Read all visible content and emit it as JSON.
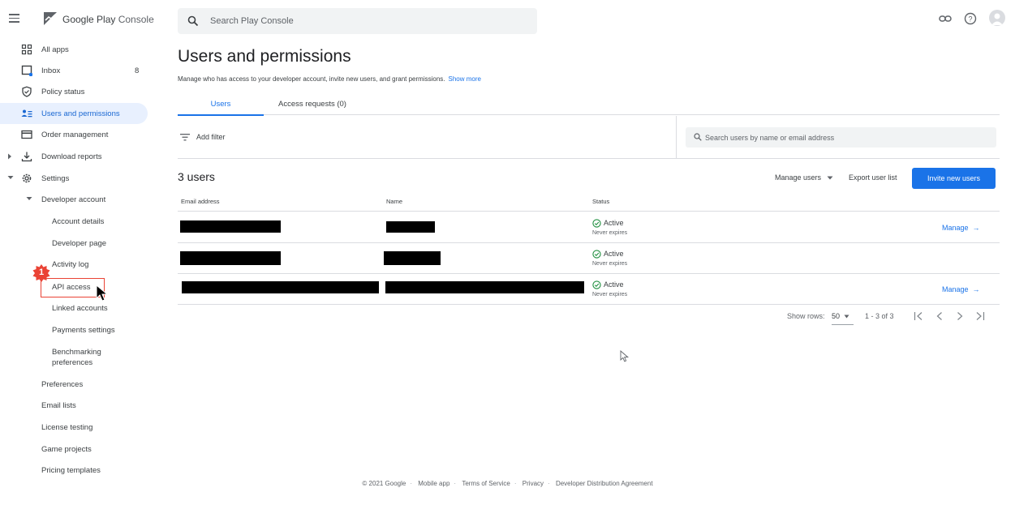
{
  "topbar": {
    "brand": "Google Play",
    "brand_suffix": "Console",
    "search_placeholder": "Search Play Console"
  },
  "sidebar": {
    "items": [
      {
        "label": "All apps",
        "icon": "grid-icon"
      },
      {
        "label": "Inbox",
        "icon": "inbox-icon",
        "count": "8"
      },
      {
        "label": "Policy status",
        "icon": "shield-icon"
      },
      {
        "label": "Users and permissions",
        "icon": "users-icon",
        "active": true
      },
      {
        "label": "Order management",
        "icon": "card-icon"
      },
      {
        "label": "Download reports",
        "icon": "download-icon"
      },
      {
        "label": "Settings",
        "icon": "gear-icon"
      }
    ],
    "developer_account": "Developer account",
    "sub_items": [
      "Account details",
      "Developer page",
      "Activity log",
      "API access",
      "Linked accounts",
      "Payments settings",
      "Benchmarking",
      "preferences"
    ],
    "settings_items": [
      "Preferences",
      "Email lists",
      "License testing",
      "Game projects",
      "Pricing templates"
    ],
    "step_badge": "1"
  },
  "main": {
    "title": "Users and permissions",
    "description": "Manage who has access to your developer account, invite new users, and grant permissions.",
    "show_more": "Show more",
    "tabs": [
      "Users",
      "Access requests (0)"
    ],
    "filter_label": "Add filter",
    "user_search_placeholder": "Search users by name or email address",
    "users_count": "3 users",
    "manage_users": "Manage users",
    "export_list": "Export user list",
    "invite_button": "Invite new users",
    "columns": [
      "Email address",
      "Name",
      "Status"
    ],
    "rows": [
      {
        "status": "Active",
        "expiry": "Never expires",
        "action": "Manage"
      },
      {
        "status": "Active",
        "expiry": "Never expires",
        "action": ""
      },
      {
        "status": "Active",
        "expiry": "Never expires",
        "action": "Manage"
      }
    ],
    "pagination": {
      "show_rows_label": "Show rows:",
      "rows_per_page": "50",
      "range": "1 - 3 of 3"
    }
  },
  "footer": {
    "copyright": "© 2021 Google",
    "links": [
      "Mobile app",
      "Terms of Service",
      "Privacy",
      "Developer Distribution Agreement"
    ]
  },
  "colors": {
    "accent": "#1a73e8",
    "active_bg": "#e8f0fe",
    "status_green": "#1e8e3e",
    "highlight_red": "#ea4335"
  }
}
